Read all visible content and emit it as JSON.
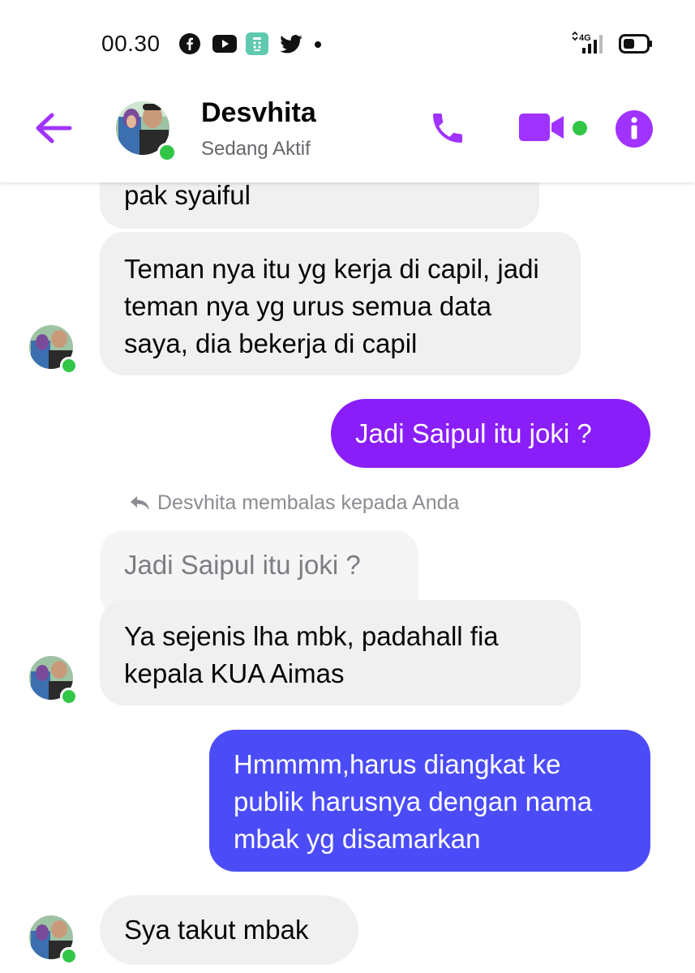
{
  "status_bar": {
    "time": "00.30",
    "network": "4G",
    "app_icons": [
      "facebook-icon",
      "youtube-icon",
      "app-icon",
      "twitter-icon"
    ]
  },
  "header": {
    "contact_name": "Desvhita",
    "contact_status": "Sedang Aktif"
  },
  "colors": {
    "accent": "#a033ff",
    "online": "#31c647",
    "incoming_bubble": "#f0f0f0",
    "outgoing_purple": "#8a1ef8",
    "outgoing_blue": "#4b4cf7"
  },
  "messages": [
    {
      "direction": "in",
      "text": "pak syaiful"
    },
    {
      "direction": "in",
      "text": "Teman nya itu yg kerja di capil, jadi teman nya yg urus semua data saya, dia bekerja di capil"
    },
    {
      "direction": "out",
      "text": "Jadi Saipul itu joki ?"
    },
    {
      "direction": "in",
      "text": "Ya sejenis lha mbk, padahall fia kepala KUA Aimas",
      "reply_label": "Desvhita membalas kepada Anda",
      "quoted_text": "Jadi Saipul itu joki ?"
    },
    {
      "direction": "out",
      "text": "Hmmmm,harus diangkat ke publik harusnya dengan nama mbak yg disamarkan"
    },
    {
      "direction": "in",
      "text": "Sya takut mbak"
    }
  ]
}
